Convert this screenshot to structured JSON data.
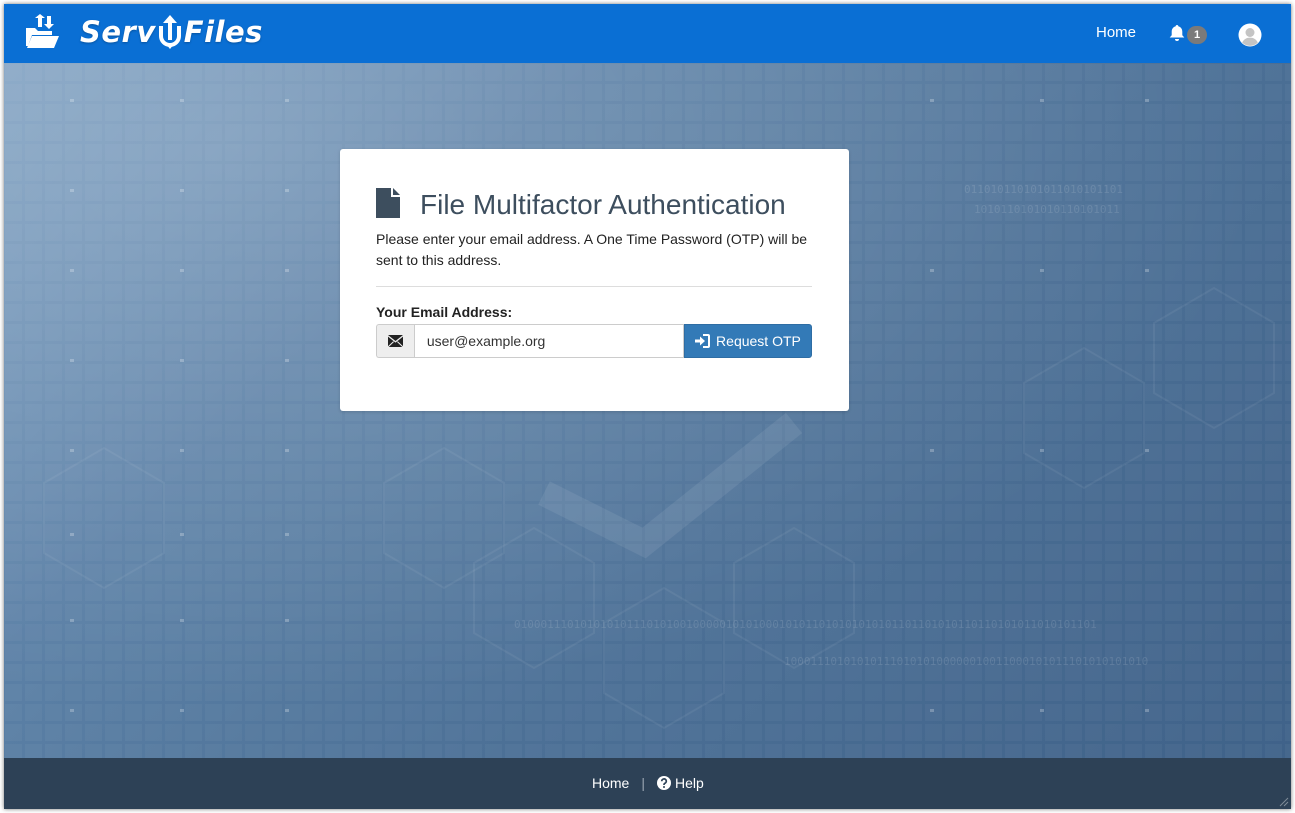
{
  "header": {
    "brand_name_left": "Serv",
    "brand_name_right": "Files",
    "nav_home": "Home",
    "notification_count": "1"
  },
  "card": {
    "title": "File Multifactor Authentication",
    "description": "Please enter your email address. A One Time Password (OTP) will be sent to this address.",
    "email_label": "Your Email Address:",
    "email_value": "user@example.org",
    "button_label": "Request OTP"
  },
  "footer": {
    "home": "Home",
    "separator": "|",
    "help": "Help"
  },
  "colors": {
    "header_bg": "#0a6fd4",
    "footer_bg": "#2d4156",
    "button_bg": "#337ab7",
    "title_text": "#3d4e5e"
  },
  "icons": [
    "folder-upload-icon",
    "bell-icon",
    "user-avatar-icon",
    "file-icon",
    "envelope-icon",
    "sign-in-icon",
    "help-circle-icon"
  ]
}
